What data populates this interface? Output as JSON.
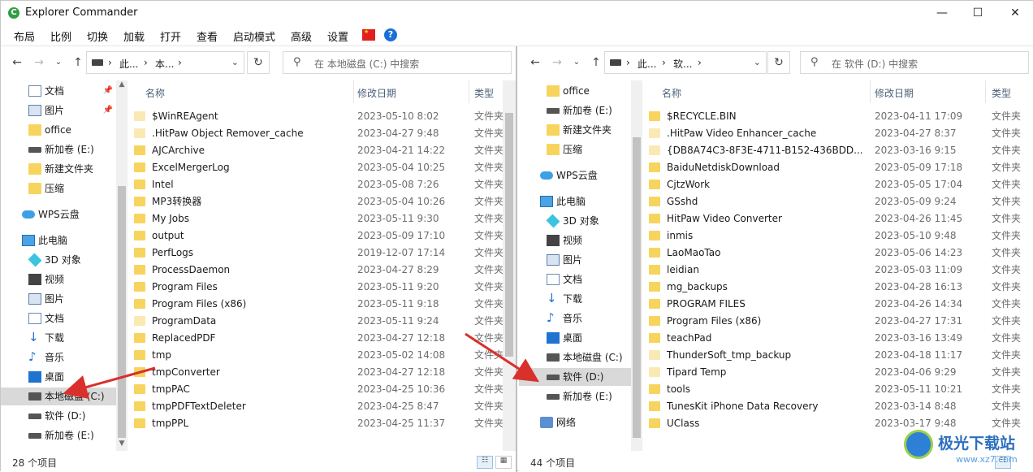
{
  "window": {
    "title": "Explorer Commander",
    "app_icon": "C",
    "controls": {
      "minimize": "—",
      "maximize": "☐",
      "close": "✕"
    }
  },
  "menu": [
    "布局",
    "比例",
    "切换",
    "加载",
    "打开",
    "查看",
    "启动模式",
    "高级",
    "设置"
  ],
  "menu_icons": {
    "flag": "china-flag-icon",
    "help": "?"
  },
  "left": {
    "address": {
      "crumb1": "此...",
      "crumb2": "本...",
      "sep": "›"
    },
    "search_placeholder": "在 本地磁盘 (C:) 中搜索",
    "tree": [
      {
        "label": "文档",
        "icon": "doc",
        "pinned": true
      },
      {
        "label": "图片",
        "icon": "pic",
        "pinned": true
      },
      {
        "label": "office",
        "icon": "folder"
      },
      {
        "label": "新加卷 (E:)",
        "icon": "drive"
      },
      {
        "label": "新建文件夹",
        "icon": "folder"
      },
      {
        "label": "压缩",
        "icon": "folder"
      },
      {
        "label": "WPS云盘",
        "icon": "cloud"
      },
      {
        "label": "此电脑",
        "icon": "pc"
      },
      {
        "label": "3D 对象",
        "icon": "3d"
      },
      {
        "label": "视频",
        "icon": "video"
      },
      {
        "label": "图片",
        "icon": "pic"
      },
      {
        "label": "文档",
        "icon": "doc"
      },
      {
        "label": "下载",
        "icon": "down"
      },
      {
        "label": "音乐",
        "icon": "music"
      },
      {
        "label": "桌面",
        "icon": "desk"
      },
      {
        "label": "本地磁盘 (C:)",
        "icon": "sysdrive",
        "selected": true
      },
      {
        "label": "软件 (D:)",
        "icon": "drive"
      },
      {
        "label": "新加卷 (E:)",
        "icon": "drive"
      }
    ],
    "columns": {
      "name": "名称",
      "date": "修改日期",
      "type": "类型"
    },
    "files": [
      {
        "name": "$WinREAgent",
        "date": "2023-05-10 8:02",
        "type": "文件夹",
        "light": true
      },
      {
        "name": ".HitPaw Object Remover_cache",
        "date": "2023-04-27 9:48",
        "type": "文件夹",
        "light": true
      },
      {
        "name": "AJCArchive",
        "date": "2023-04-21 14:22",
        "type": "文件夹"
      },
      {
        "name": "ExcelMergerLog",
        "date": "2023-05-04 10:25",
        "type": "文件夹"
      },
      {
        "name": "Intel",
        "date": "2023-05-08 7:26",
        "type": "文件夹"
      },
      {
        "name": "MP3转换器",
        "date": "2023-05-04 10:26",
        "type": "文件夹"
      },
      {
        "name": "My Jobs",
        "date": "2023-05-11 9:30",
        "type": "文件夹"
      },
      {
        "name": "output",
        "date": "2023-05-09 17:10",
        "type": "文件夹"
      },
      {
        "name": "PerfLogs",
        "date": "2019-12-07 17:14",
        "type": "文件夹"
      },
      {
        "name": "ProcessDaemon",
        "date": "2023-04-27 8:29",
        "type": "文件夹"
      },
      {
        "name": "Program Files",
        "date": "2023-05-11 9:20",
        "type": "文件夹"
      },
      {
        "name": "Program Files (x86)",
        "date": "2023-05-11 9:18",
        "type": "文件夹"
      },
      {
        "name": "ProgramData",
        "date": "2023-05-11 9:24",
        "type": "文件夹",
        "light": true
      },
      {
        "name": "ReplacedPDF",
        "date": "2023-04-27 12:18",
        "type": "文件夹"
      },
      {
        "name": "tmp",
        "date": "2023-05-02 14:08",
        "type": "文件夹"
      },
      {
        "name": "tmpConverter",
        "date": "2023-04-27 12:18",
        "type": "文件夹"
      },
      {
        "name": "tmpPAC",
        "date": "2023-04-25 10:36",
        "type": "文件夹"
      },
      {
        "name": "tmpPDFTextDeleter",
        "date": "2023-04-25 8:47",
        "type": "文件夹"
      },
      {
        "name": "tmpPPL",
        "date": "2023-04-25 11:37",
        "type": "文件夹"
      }
    ],
    "status": "28 个项目"
  },
  "right": {
    "address": {
      "crumb1": "此...",
      "crumb2": "软...",
      "sep": "›"
    },
    "search_placeholder": "在 软件 (D:) 中搜索",
    "tree": [
      {
        "label": "office",
        "icon": "folder"
      },
      {
        "label": "新加卷 (E:)",
        "icon": "drive"
      },
      {
        "label": "新建文件夹",
        "icon": "folder"
      },
      {
        "label": "压缩",
        "icon": "folder"
      },
      {
        "label": "WPS云盘",
        "icon": "cloud"
      },
      {
        "label": "此电脑",
        "icon": "pc"
      },
      {
        "label": "3D 对象",
        "icon": "3d"
      },
      {
        "label": "视频",
        "icon": "video"
      },
      {
        "label": "图片",
        "icon": "pic"
      },
      {
        "label": "文档",
        "icon": "doc"
      },
      {
        "label": "下载",
        "icon": "down"
      },
      {
        "label": "音乐",
        "icon": "music"
      },
      {
        "label": "桌面",
        "icon": "desk"
      },
      {
        "label": "本地磁盘 (C:)",
        "icon": "sysdrive"
      },
      {
        "label": "软件 (D:)",
        "icon": "drive",
        "selected": true
      },
      {
        "label": "新加卷 (E:)",
        "icon": "drive"
      },
      {
        "label": "网络",
        "icon": "net"
      }
    ],
    "columns": {
      "name": "名称",
      "date": "修改日期",
      "type": "类型"
    },
    "files": [
      {
        "name": "$RECYCLE.BIN",
        "date": "2023-04-11 17:09",
        "type": "文件夹"
      },
      {
        "name": ".HitPaw Video Enhancer_cache",
        "date": "2023-04-27 8:37",
        "type": "文件夹",
        "light": true
      },
      {
        "name": "{DB8A74C3-8F3E-4711-B152-436BDD...",
        "date": "2023-03-16 9:15",
        "type": "文件夹",
        "light": true
      },
      {
        "name": "BaiduNetdiskDownload",
        "date": "2023-05-09 17:18",
        "type": "文件夹"
      },
      {
        "name": "CjtzWork",
        "date": "2023-05-05 17:04",
        "type": "文件夹"
      },
      {
        "name": "GSshd",
        "date": "2023-05-09 9:24",
        "type": "文件夹"
      },
      {
        "name": "HitPaw Video Converter",
        "date": "2023-04-26 11:45",
        "type": "文件夹"
      },
      {
        "name": "inmis",
        "date": "2023-05-10 9:48",
        "type": "文件夹"
      },
      {
        "name": "LaoMaoTao",
        "date": "2023-05-06 14:23",
        "type": "文件夹"
      },
      {
        "name": "leidian",
        "date": "2023-05-03 11:09",
        "type": "文件夹"
      },
      {
        "name": "mg_backups",
        "date": "2023-04-28 16:13",
        "type": "文件夹"
      },
      {
        "name": "PROGRAM FILES",
        "date": "2023-04-26 14:34",
        "type": "文件夹"
      },
      {
        "name": "Program Files (x86)",
        "date": "2023-04-27 17:31",
        "type": "文件夹"
      },
      {
        "name": "teachPad",
        "date": "2023-03-16 13:49",
        "type": "文件夹"
      },
      {
        "name": "ThunderSoft_tmp_backup",
        "date": "2023-04-18 11:17",
        "type": "文件夹",
        "light": true
      },
      {
        "name": "Tipard Temp",
        "date": "2023-04-06 9:29",
        "type": "文件夹",
        "light": true
      },
      {
        "name": "tools",
        "date": "2023-05-11 10:21",
        "type": "文件夹"
      },
      {
        "name": "TunesKit iPhone Data Recovery",
        "date": "2023-03-14 8:48",
        "type": "文件夹"
      },
      {
        "name": "UClass",
        "date": "2023-03-17 9:48",
        "type": "文件夹"
      }
    ],
    "status": "44 个项目"
  },
  "watermark": {
    "name": "极光下载站",
    "url": "www.xz7.com"
  },
  "colors": {
    "annotation_arrow": "#d9302c",
    "selection": "#d9d9d9",
    "folder": "#f7d45e"
  }
}
